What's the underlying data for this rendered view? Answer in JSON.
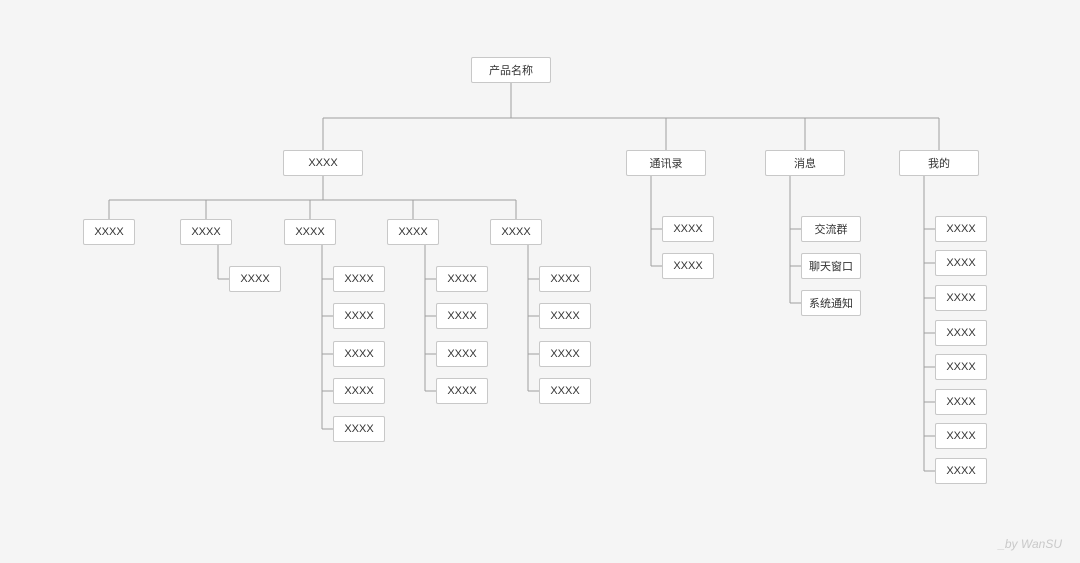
{
  "root": {
    "label": "产品名称"
  },
  "l1": {
    "a": {
      "label": "XXXX"
    },
    "b": {
      "label": "通讯录"
    },
    "c": {
      "label": "消息"
    },
    "d": {
      "label": "我的"
    }
  },
  "a_children": [
    {
      "label": "XXXX"
    },
    {
      "label": "XXXX"
    },
    {
      "label": "XXXX"
    },
    {
      "label": "XXXX"
    },
    {
      "label": "XXXX"
    }
  ],
  "a2_children": [
    {
      "label": "XXXX"
    }
  ],
  "a3_children": [
    {
      "label": "XXXX"
    },
    {
      "label": "XXXX"
    },
    {
      "label": "XXXX"
    },
    {
      "label": "XXXX"
    },
    {
      "label": "XXXX"
    }
  ],
  "a4_children": [
    {
      "label": "XXXX"
    },
    {
      "label": "XXXX"
    },
    {
      "label": "XXXX"
    },
    {
      "label": "XXXX"
    }
  ],
  "a5_children": [
    {
      "label": "XXXX"
    },
    {
      "label": "XXXX"
    },
    {
      "label": "XXXX"
    },
    {
      "label": "XXXX"
    }
  ],
  "b_children": [
    {
      "label": "XXXX"
    },
    {
      "label": "XXXX"
    }
  ],
  "c_children": [
    {
      "label": "交流群"
    },
    {
      "label": "聊天窗口"
    },
    {
      "label": "系统通知"
    }
  ],
  "d_children": [
    {
      "label": "XXXX"
    },
    {
      "label": "XXXX"
    },
    {
      "label": "XXXX"
    },
    {
      "label": "XXXX"
    },
    {
      "label": "XXXX"
    },
    {
      "label": "XXXX"
    },
    {
      "label": "XXXX"
    },
    {
      "label": "XXXX"
    }
  ],
  "credit": "_by WanSU"
}
